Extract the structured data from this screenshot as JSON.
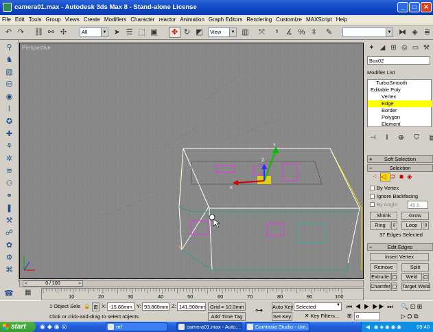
{
  "window": {
    "title": "camera01.max - Autodesk 3ds Max 8 - Stand-alone License",
    "minimize": "_",
    "maximize": "□",
    "close": "✕"
  },
  "menu": [
    "File",
    "Edit",
    "Tools",
    "Group",
    "Views",
    "Create",
    "Modifiers",
    "Character",
    "reactor",
    "Animation",
    "Graph Editors",
    "Rendering",
    "Customize",
    "MAXScript",
    "Help"
  ],
  "toolbar": {
    "selection_filter": "All",
    "reference_coord": "View"
  },
  "viewport": {
    "label": "Perspective",
    "gizmo_axis_labels": {
      "x": "X",
      "y": "Y",
      "z": "Z"
    }
  },
  "timeline": {
    "frame_display": "0 / 100",
    "prev": "<",
    "next": ">",
    "ticks": [
      "10",
      "20",
      "30",
      "40",
      "50",
      "60",
      "70",
      "80",
      "90",
      "100"
    ]
  },
  "status": {
    "object_count": "1 Object Sele",
    "prompt": "Click or click-and-drag to select objects",
    "x_label": "X:",
    "x_value": "-15.66mm",
    "y_label": "Y:",
    "y_value": "93.868mm",
    "z_label": "Z:",
    "z_value": "141.908mm",
    "grid": "Grid = 10.0mm",
    "add_time_tag": "Add Time Tag",
    "auto_key": "Auto Key",
    "set_key": "Set Key",
    "key_mode": "Selected",
    "key_filters": "Key Filters...",
    "frame_field": "0"
  },
  "command_panel": {
    "object_name": "Box02",
    "modifier_list": "Modifier List",
    "stack": [
      {
        "label": "TurboSmooth",
        "indent": 1,
        "selected": false
      },
      {
        "label": "Editable Poly",
        "indent": 0,
        "selected": false
      },
      {
        "label": "Vertex",
        "indent": 2,
        "selected": false
      },
      {
        "label": "Edge",
        "indent": 2,
        "selected": true
      },
      {
        "label": "Border",
        "indent": 2,
        "selected": false
      },
      {
        "label": "Polygon",
        "indent": 2,
        "selected": false
      },
      {
        "label": "Element",
        "indent": 2,
        "selected": false
      }
    ],
    "soft_selection": "Soft Selection",
    "selection": "Selection",
    "by_vertex": "By Vertex",
    "ignore_backfacing": "Ignore Backfacing",
    "by_angle": "By Angle:",
    "by_angle_value": "45.0",
    "shrink": "Shrink",
    "grow": "Grow",
    "ring": "Ring",
    "loop": "Loop",
    "selected_info": "37 Edges Selected",
    "edit_edges": "Edit Edges",
    "insert_vertex": "Insert Vertex",
    "remove": "Remove",
    "split": "Split",
    "extrude": "Extrude",
    "weld": "Weld",
    "chamfer": "Chamfer",
    "target_weld": "Target Weld"
  },
  "taskbar": {
    "start": "start",
    "tasks": [
      "ref",
      "camera01.max - Auto...",
      "Camtasia Studio - Unt..."
    ],
    "clock": "09:40"
  }
}
